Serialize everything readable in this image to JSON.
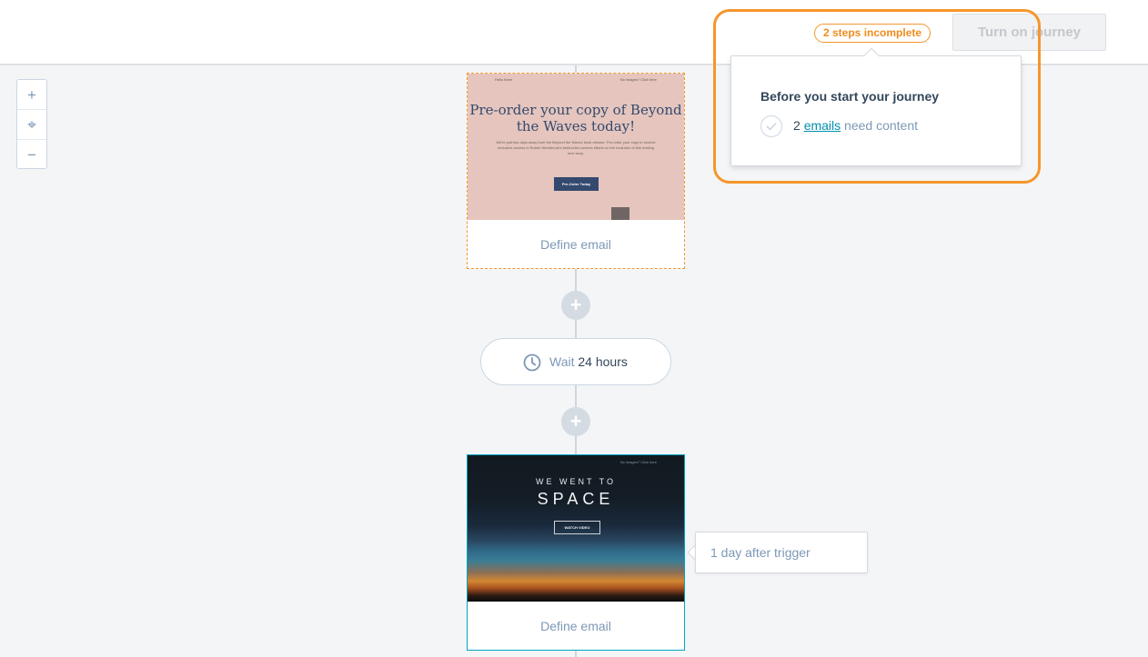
{
  "header": {
    "steps_badge": "2 steps incomplete",
    "turn_on_label": "Turn on journey"
  },
  "popover": {
    "title": "Before you start your journey",
    "count": "2",
    "link_text": "emails",
    "suffix": "need content"
  },
  "zoom": {
    "in": "+",
    "center": "⌖",
    "out": "−"
  },
  "steps": {
    "email1": {
      "label": "Define email",
      "preview": {
        "top_left": "Hello there",
        "top_right": "No images? Click here",
        "headline": "Pre-order your copy of Beyond the Waves today!",
        "body": "We're just two days away from the Beyond the Waves book release. Pre-order your copy to receive exclusive access to Robert Westbrook's behind-the-scenes efforts on the evolution of this riveting love story.",
        "button": "Pre-Order Today",
        "side_button": "Share"
      }
    },
    "add_button": "+",
    "wait": {
      "prefix": "Wait",
      "value": "24 hours"
    },
    "email2": {
      "label": "Define email",
      "trigger_note": "1 day after trigger",
      "preview": {
        "top_right": "No images? Click here",
        "small_heading": "WE WENT TO",
        "big_heading": "SPACE",
        "button": "WATCH VIDEO"
      }
    }
  }
}
